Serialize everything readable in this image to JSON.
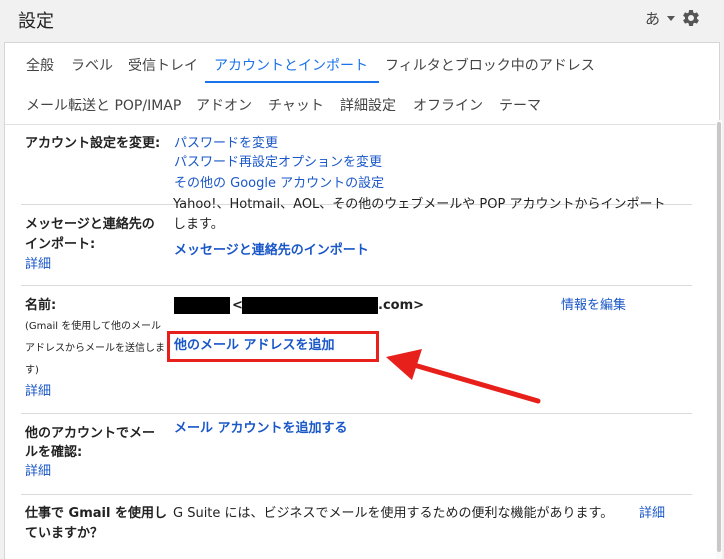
{
  "header": {
    "title": "設定",
    "lang_label": "あ"
  },
  "tabs": {
    "row1": [
      "全般",
      "ラベル",
      "受信トレイ",
      "アカウントとインポート",
      "フィルタとブロック中のアドレス"
    ],
    "row2": [
      "メール転送と POP/IMAP",
      "アドオン",
      "チャット",
      "詳細設定",
      "オフライン",
      "テーマ"
    ],
    "active": "アカウントとインポート"
  },
  "sections": {
    "change_account": {
      "label": "アカウント設定を変更:",
      "links": [
        "パスワードを変更",
        "パスワード再設定オプションを変更",
        "その他の Google アカウントの設定"
      ]
    },
    "import": {
      "label_line1": "メッセージと連絡先の",
      "label_line2": "インポート:",
      "detail": "詳細",
      "desc_line1": "Yahoo!、Hotmail、AOL、その他のウェブメールや POP アカウントからインポート",
      "desc_line2": "します。",
      "link": "メッセージと連絡先のインポート"
    },
    "name": {
      "label": "名前:",
      "note_line1": "(Gmail を使用して他のメール",
      "note_line2": "アドレスからメールを送信しま",
      "note_line3": "す)",
      "detail": "詳細",
      "email_open": "<",
      "email_suffix": ".com>",
      "edit_link": "情報を編集",
      "add_address_link": "他のメール アドレスを追加"
    },
    "check_mail": {
      "label_line1": "他のアカウントでメー",
      "label_line2": "ルを確認:",
      "detail": "詳細",
      "link": "メール アカウントを追加する"
    },
    "gsuite": {
      "label_line1": "仕事で Gmail を使用し",
      "label_line2": "ていますか？",
      "desc": "G Suite には、ビジネスでメールを使用するための便利な機能があります。",
      "link": "詳細"
    }
  },
  "colors": {
    "link": "#1a57c8",
    "active_tab": "#1a73e8",
    "annotation": "#e8201c"
  },
  "icons": {
    "settings": "gear-icon",
    "dropdown": "chevron-down-icon",
    "annotation_arrow": "arrow-icon"
  }
}
